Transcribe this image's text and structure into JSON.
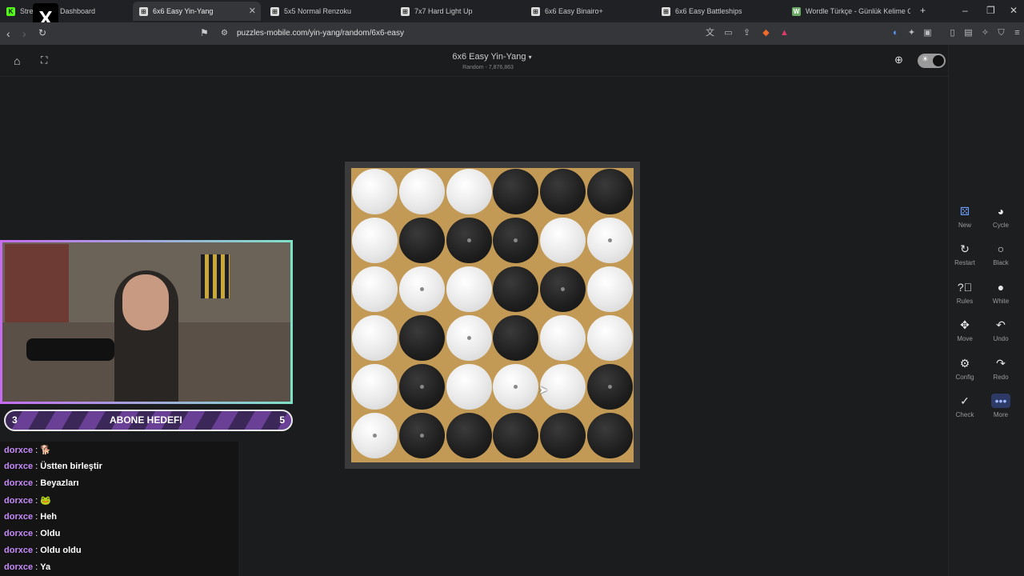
{
  "browser": {
    "tabs": [
      {
        "label": "Stre",
        "favicon": "kick-icon",
        "active": false
      },
      {
        "label": "Dashboard",
        "favicon": "",
        "active": false
      },
      {
        "label": "6x6 Easy Yin-Yang",
        "favicon": "puzzle-icon",
        "active": true
      },
      {
        "label": "5x5 Normal Renzoku",
        "favicon": "puzzle-icon",
        "active": false
      },
      {
        "label": "7x7 Hard Light Up",
        "favicon": "puzzle-icon",
        "active": false
      },
      {
        "label": "6x6 Easy Binairo+",
        "favicon": "puzzle-icon",
        "active": false
      },
      {
        "label": "6x6 Easy Battleships",
        "favicon": "puzzle-icon",
        "active": false
      },
      {
        "label": "Wordle Türkçe - Günlük Kelime Oyu",
        "favicon": "wordle-icon",
        "active": false
      }
    ],
    "url": "puzzles-mobile.com/yin-yang/random/6x6-easy"
  },
  "header": {
    "title": "6x6 Easy Yin-Yang",
    "subtitle": "Random - 7,876,863"
  },
  "board": {
    "rows": 6,
    "cols": 6,
    "cells": [
      [
        "W",
        "W",
        "W",
        "B",
        "B",
        "B"
      ],
      [
        "W",
        "B",
        "B",
        "B",
        "W",
        "W"
      ],
      [
        "W",
        "W",
        "W",
        "B",
        "B",
        "W"
      ],
      [
        "W",
        "B",
        "W",
        "B",
        "W",
        "W"
      ],
      [
        "W",
        "B",
        "W",
        "W",
        "W",
        "B"
      ],
      [
        "W",
        "B",
        "B",
        "B",
        "B",
        "B"
      ]
    ],
    "given_marks": [
      [
        0,
        0,
        0,
        0,
        0,
        0
      ],
      [
        0,
        0,
        1,
        1,
        0,
        1
      ],
      [
        0,
        1,
        0,
        0,
        1,
        0
      ],
      [
        0,
        0,
        1,
        0,
        0,
        0
      ],
      [
        0,
        1,
        0,
        1,
        0,
        1
      ],
      [
        1,
        1,
        0,
        0,
        0,
        0
      ]
    ],
    "colors": {
      "frame": "#3b3b3b",
      "wood": "#c39a55"
    }
  },
  "tools": {
    "new": "New",
    "cycle": "Cycle",
    "restart": "Restart",
    "black": "Black",
    "rules": "Rules",
    "white": "White",
    "move": "Move",
    "undo": "Undo",
    "config": "Config",
    "redo": "Redo",
    "check": "Check",
    "more": "More"
  },
  "stream": {
    "goal_current": "3",
    "goal_label": "ABONE HEDEFI",
    "goal_target": "5",
    "chat": [
      {
        "user": "dorxce",
        "msg": ""
      },
      {
        "user": "dorxce",
        "msg": "Üstten birleştir"
      },
      {
        "user": "dorxce",
        "msg": "Beyazları"
      },
      {
        "user": "dorxce",
        "msg": ""
      },
      {
        "user": "dorxce",
        "msg": "Heh"
      },
      {
        "user": "dorxce",
        "msg": "Oldu"
      },
      {
        "user": "dorxce",
        "msg": "Oldu oldu"
      },
      {
        "user": "dorxce",
        "msg": "Ya"
      }
    ]
  },
  "accent": "#c58af9"
}
